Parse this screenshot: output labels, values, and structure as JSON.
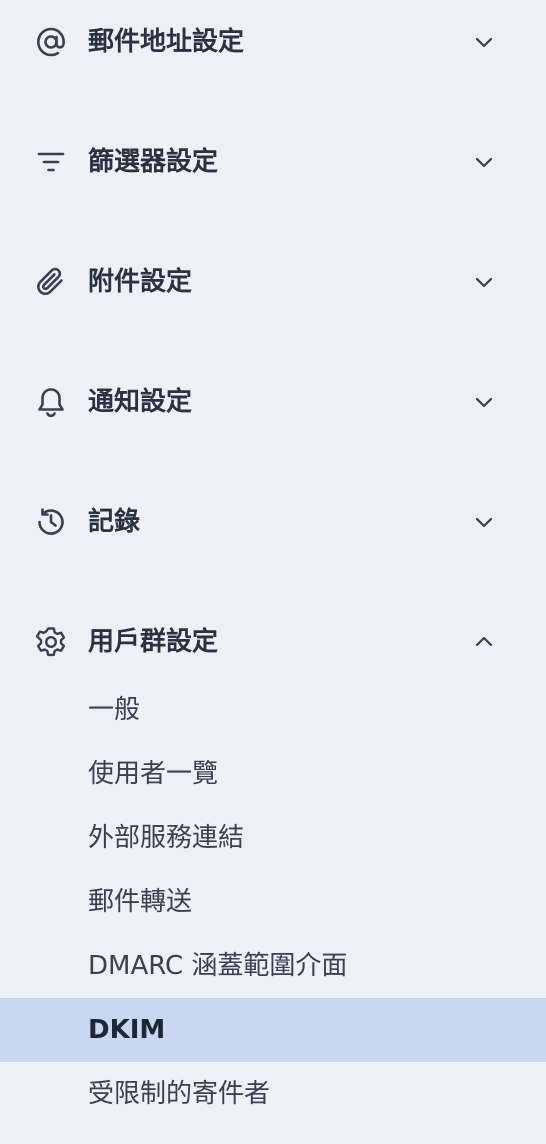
{
  "nav": {
    "sections": [
      {
        "label": "郵件地址設定",
        "icon": "at-sign-icon",
        "expanded": false
      },
      {
        "label": "篩選器設定",
        "icon": "filter-icon",
        "expanded": false
      },
      {
        "label": "附件設定",
        "icon": "paperclip-icon",
        "expanded": false
      },
      {
        "label": "通知設定",
        "icon": "bell-icon",
        "expanded": false
      },
      {
        "label": "記錄",
        "icon": "history-icon",
        "expanded": false
      },
      {
        "label": "用戶群設定",
        "icon": "gear-icon",
        "expanded": true
      }
    ],
    "subitems": [
      {
        "label": "一般",
        "active": false
      },
      {
        "label": "使用者一覽",
        "active": false
      },
      {
        "label": "外部服務連結",
        "active": false
      },
      {
        "label": "郵件轉送",
        "active": false
      },
      {
        "label": "DMARC 涵蓋範圍介面",
        "active": false
      },
      {
        "label": "DKIM",
        "active": true
      },
      {
        "label": "受限制的寄件者",
        "active": false
      }
    ]
  },
  "colors": {
    "background": "#eef0f5",
    "text": "#2b3142",
    "active_background": "#c8d6f2"
  }
}
